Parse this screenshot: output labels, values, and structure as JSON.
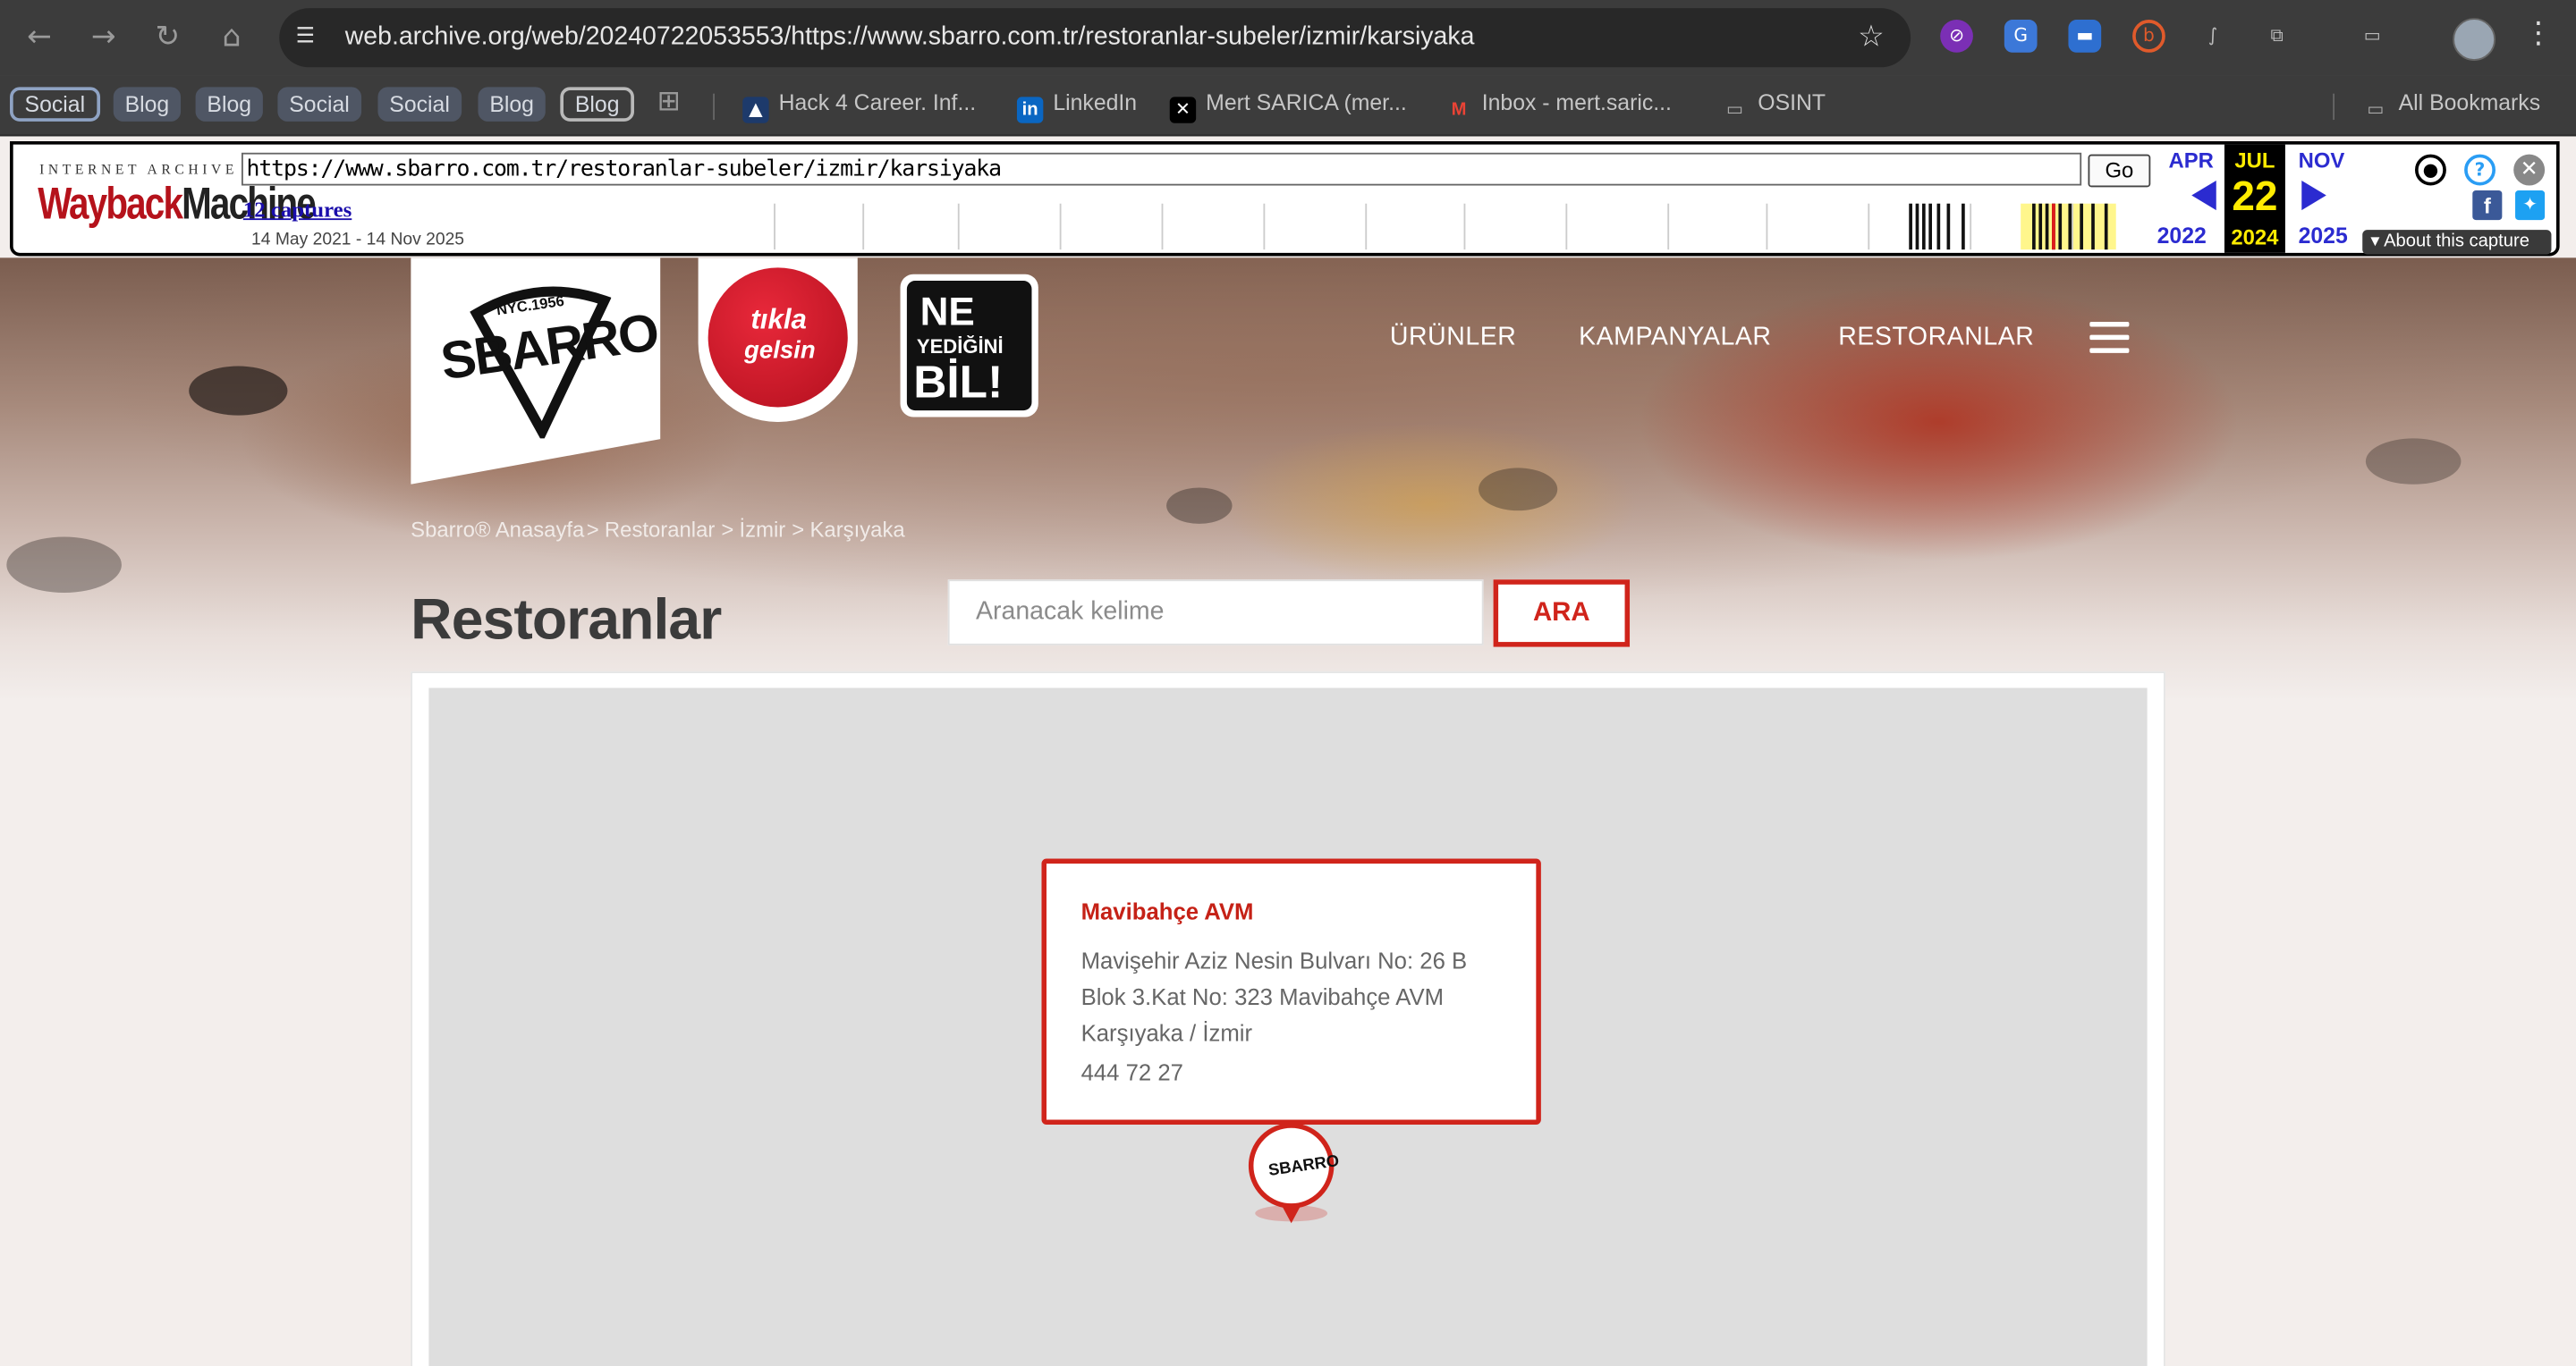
{
  "browser": {
    "url": "web.archive.org/web/20240722053553/https://www.sbarro.com.tr/restoranlar-subeler/izmir/karsiyaka",
    "bookmarks": [
      "Social",
      "Blog",
      "Blog",
      "Social",
      "Social",
      "Blog",
      "Blog"
    ],
    "bookmark_links": [
      "Hack 4 Career. Inf...",
      "LinkedIn",
      "Mert SARICA (mer...",
      "Inbox - mert.saric...",
      "OSINT"
    ],
    "all_bookmarks": "All Bookmarks"
  },
  "wayback": {
    "logo_top": "INTERNET ARCHIVE",
    "logo_wayback": "Wayback",
    "logo_machine": "Machine",
    "url_field": "https://www.sbarro.com.tr/restoranlar-subeler/izmir/karsiyaka",
    "go": "Go",
    "captures": "12 captures",
    "range": "14 May 2021 - 14 Nov 2025",
    "prev_month": "APR",
    "prev_year": "2022",
    "cur_month": "JUL",
    "cur_day": "22",
    "cur_year": "2024",
    "next_month": "NOV",
    "next_year": "2025",
    "about": "About this capture"
  },
  "site": {
    "logos": {
      "sbarro": "SBARRO",
      "sbarro_nyc": "NYC.1956",
      "tikla_1": "tıkla",
      "tikla_2": "gelsin",
      "ne_1": "NE",
      "ne_2": "YEDİĞİNİ",
      "ne_3": "BİL!"
    },
    "nav": [
      "ÜRÜNLER",
      "KAMPANYALAR",
      "RESTORANLAR"
    ],
    "breadcrumb": [
      "Sbarro® Anasayfa",
      "Restoranlar",
      "İzmir",
      "Karşıyaka"
    ],
    "page_title": "Restoranlar",
    "search_placeholder": "Aranacak kelime",
    "search_button": "ARA",
    "store": {
      "name": "Mavibahçe AVM",
      "address_lines": [
        "Mavişehir Aziz Nesin Bulvarı No: 26 B",
        "Blok 3.Kat No: 323 Mavibahçe AVM",
        "Karşıyaka / İzmir"
      ],
      "phone": "444 72 27"
    },
    "pin_label": "SBARRO"
  },
  "colors": {
    "brand_red": "#d0241b",
    "wayback_blue": "#2b2bd0",
    "highlight_yellow": "#ffec00"
  }
}
